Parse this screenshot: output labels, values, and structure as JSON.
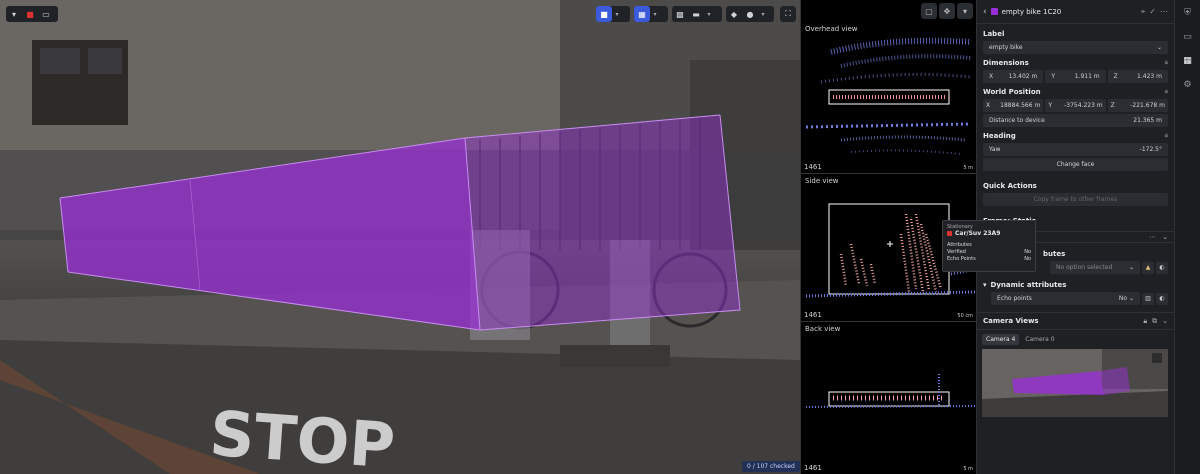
{
  "viewport": {
    "checked_status": "0 / 107 checked"
  },
  "views": {
    "overhead": {
      "title": "Overhead view",
      "frame": "1461",
      "scale": "5 m"
    },
    "side": {
      "title": "Side view",
      "frame": "1461",
      "scale": "50 cm"
    },
    "back": {
      "title": "Back view",
      "frame": "1461",
      "scale": "5 m"
    }
  },
  "tooltip": {
    "state": "Stationary",
    "object": "Car/Suv 23A9",
    "section": "Attributes",
    "rows": [
      {
        "key": "Verified",
        "value": "No"
      },
      {
        "key": "Echo Points",
        "value": "No"
      }
    ]
  },
  "panel": {
    "object_name": "empty bike 1C20",
    "label_heading": "Label",
    "label_value": "empty bike",
    "dimensions_heading": "Dimensions",
    "dimensions": [
      {
        "axis": "X",
        "value": "13.402 m"
      },
      {
        "axis": "Y",
        "value": "1.911 m"
      },
      {
        "axis": "Z",
        "value": "1.423 m"
      }
    ],
    "world_heading": "World Position",
    "world": [
      {
        "axis": "X",
        "value": "18884.566 m"
      },
      {
        "axis": "Y",
        "value": "-3754.223 m"
      },
      {
        "axis": "Z",
        "value": "-221.678 m"
      }
    ],
    "distance_label": "Distance to device",
    "distance_value": "21.365 m",
    "heading_heading": "Heading",
    "yaw_label": "Yaw",
    "yaw_value": "-172.5°",
    "change_face": "Change face",
    "quick_actions": "Quick Actions",
    "copy_frame": "Copy frame to other frames",
    "frame_static": "Frame: Static",
    "attributes_partial": "butes",
    "no_option": "No option selected",
    "dynamic_attributes": "Dynamic attributes",
    "echo_points": "Echo points",
    "echo_value": "No",
    "camera_views": "Camera Views",
    "camera_tabs": [
      "Camera 4",
      "Camera 0"
    ]
  },
  "colors": {
    "cuboid": "#9a2fd6",
    "accent": "#3b5bdb"
  }
}
